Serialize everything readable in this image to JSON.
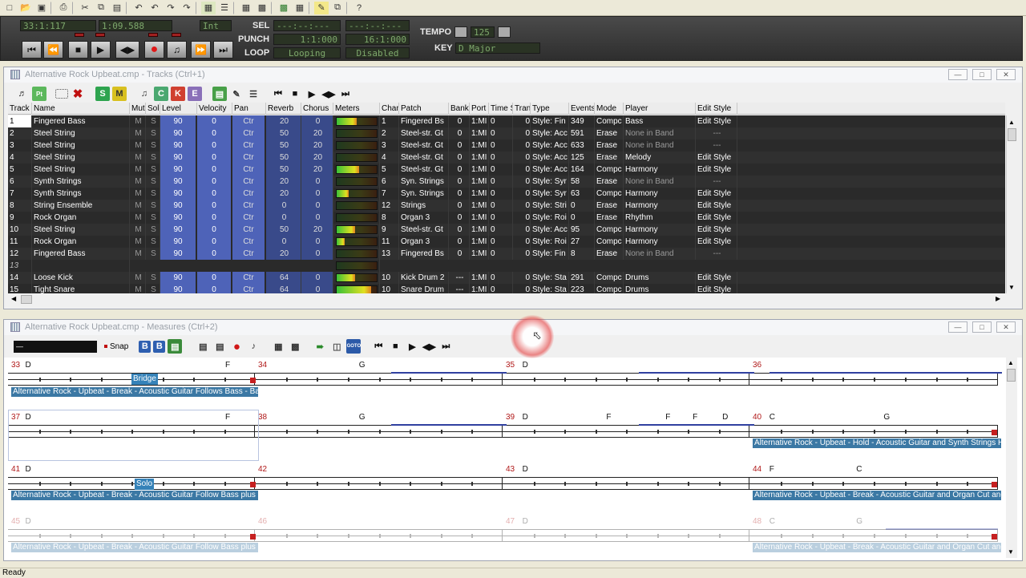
{
  "transport": {
    "now_time": "33:1:117",
    "now_clock": "1:09.588",
    "sync": "Int",
    "sel_label": "SEL",
    "sel_from": "---:--:---",
    "sel_to": "---:--:---",
    "punch_label": "PUNCH",
    "punch_from": "1:1:000",
    "punch_to": "16:1:000",
    "loop_label": "LOOP",
    "loop_from": "Looping",
    "loop_to": "Disabled",
    "tempo_label": "TEMPO",
    "tempo_value": "125",
    "key_label": "KEY",
    "key_value": "D Major"
  },
  "tracks_window": {
    "title": "Alternative Rock Upbeat.cmp - Tracks (Ctrl+1)",
    "columns": [
      "Track",
      "Name",
      "Mut",
      "Solo",
      "Level",
      "Velocity",
      "Pan",
      "Reverb",
      "Chorus",
      "Meters",
      "Chan",
      "Patch",
      "Bank",
      "Port",
      "Time S",
      "Tran",
      "Type",
      "Events",
      "Mode",
      "Player",
      "Edit Style"
    ],
    "rows": [
      {
        "n": "1",
        "name": "Fingered Bass",
        "level": "90",
        "vel": "0",
        "pan": "Ctr",
        "rev": "20",
        "cho": "0",
        "meter": 0.5,
        "chan": "1",
        "patch": "Fingered Bs",
        "bank": "0",
        "port": "1:MI",
        "ts": "0",
        "tran": "0",
        "type": "Style: Fin",
        "events": "349",
        "mode": "Compc",
        "player": "Bass",
        "edit": "Edit Style",
        "playerdim": false
      },
      {
        "n": "2",
        "name": "Steel String",
        "level": "90",
        "vel": "0",
        "pan": "Ctr",
        "rev": "50",
        "cho": "20",
        "meter": 0,
        "chan": "2",
        "patch": "Steel-str. Gt",
        "bank": "0",
        "port": "1:MI",
        "ts": "0",
        "tran": "0",
        "type": "Style: Acc",
        "events": "591",
        "mode": "Erase",
        "player": "None in Band",
        "edit": "---",
        "playerdim": true
      },
      {
        "n": "3",
        "name": "Steel String",
        "level": "90",
        "vel": "0",
        "pan": "Ctr",
        "rev": "50",
        "cho": "20",
        "meter": 0,
        "chan": "3",
        "patch": "Steel-str. Gt",
        "bank": "0",
        "port": "1:MI",
        "ts": "0",
        "tran": "0",
        "type": "Style: Acc",
        "events": "633",
        "mode": "Erase",
        "player": "None in Band",
        "edit": "---",
        "playerdim": true
      },
      {
        "n": "4",
        "name": "Steel String",
        "level": "90",
        "vel": "0",
        "pan": "Ctr",
        "rev": "50",
        "cho": "20",
        "meter": 0,
        "chan": "4",
        "patch": "Steel-str. Gt",
        "bank": "0",
        "port": "1:MI",
        "ts": "0",
        "tran": "0",
        "type": "Style: Acc",
        "events": "125",
        "mode": "Erase",
        "player": "Melody",
        "edit": "Edit Style",
        "playerdim": false
      },
      {
        "n": "5",
        "name": "Steel String",
        "level": "90",
        "vel": "0",
        "pan": "Ctr",
        "rev": "50",
        "cho": "20",
        "meter": 0.55,
        "chan": "5",
        "patch": "Steel-str. Gt",
        "bank": "0",
        "port": "1:MI",
        "ts": "0",
        "tran": "0",
        "type": "Style: Acc",
        "events": "164",
        "mode": "Compc",
        "player": "Harmony",
        "edit": "Edit Style",
        "playerdim": false
      },
      {
        "n": "6",
        "name": "Synth Strings",
        "level": "90",
        "vel": "0",
        "pan": "Ctr",
        "rev": "20",
        "cho": "0",
        "meter": 0,
        "chan": "6",
        "patch": "Syn. Strings",
        "bank": "0",
        "port": "1:MI",
        "ts": "0",
        "tran": "0",
        "type": "Style: Syr",
        "events": "58",
        "mode": "Erase",
        "player": "None in Band",
        "edit": "---",
        "playerdim": true
      },
      {
        "n": "7",
        "name": "Synth Strings",
        "level": "90",
        "vel": "0",
        "pan": "Ctr",
        "rev": "20",
        "cho": "0",
        "meter": 0.3,
        "chan": "7",
        "patch": "Syn. Strings",
        "bank": "0",
        "port": "1:MI",
        "ts": "0",
        "tran": "0",
        "type": "Style: Syr",
        "events": "63",
        "mode": "Compc",
        "player": "Harmony",
        "edit": "Edit Style",
        "playerdim": false
      },
      {
        "n": "8",
        "name": "String Ensemble",
        "level": "90",
        "vel": "0",
        "pan": "Ctr",
        "rev": "0",
        "cho": "0",
        "meter": 0,
        "chan": "12",
        "patch": "Strings",
        "bank": "0",
        "port": "1:MI",
        "ts": "0",
        "tran": "0",
        "type": "Style: Stri",
        "events": "0",
        "mode": "Erase",
        "player": "Harmony",
        "edit": "Edit Style",
        "playerdim": false
      },
      {
        "n": "9",
        "name": "Rock Organ",
        "level": "90",
        "vel": "0",
        "pan": "Ctr",
        "rev": "0",
        "cho": "0",
        "meter": 0,
        "chan": "8",
        "patch": "Organ 3",
        "bank": "0",
        "port": "1:MI",
        "ts": "0",
        "tran": "0",
        "type": "Style: Roi",
        "events": "0",
        "mode": "Erase",
        "player": "Rhythm",
        "edit": "Edit Style",
        "playerdim": false
      },
      {
        "n": "10",
        "name": "Steel String",
        "level": "90",
        "vel": "0",
        "pan": "Ctr",
        "rev": "50",
        "cho": "20",
        "meter": 0.45,
        "chan": "9",
        "patch": "Steel-str. Gt",
        "bank": "0",
        "port": "1:MI",
        "ts": "0",
        "tran": "0",
        "type": "Style: Acc",
        "events": "95",
        "mode": "Compc",
        "player": "Harmony",
        "edit": "Edit Style",
        "playerdim": false
      },
      {
        "n": "11",
        "name": "Rock Organ",
        "level": "90",
        "vel": "0",
        "pan": "Ctr",
        "rev": "0",
        "cho": "0",
        "meter": 0.2,
        "chan": "11",
        "patch": "Organ 3",
        "bank": "0",
        "port": "1:MI",
        "ts": "0",
        "tran": "0",
        "type": "Style: Roi",
        "events": "27",
        "mode": "Compc",
        "player": "Harmony",
        "edit": "Edit Style",
        "playerdim": false
      },
      {
        "n": "12",
        "name": "Fingered Bass",
        "level": "90",
        "vel": "0",
        "pan": "Ctr",
        "rev": "20",
        "cho": "0",
        "meter": 0,
        "chan": "13",
        "patch": "Fingered Bs",
        "bank": "0",
        "port": "1:MI",
        "ts": "0",
        "tran": "0",
        "type": "Style: Fin",
        "events": "8",
        "mode": "Erase",
        "player": "None in Band",
        "edit": "---",
        "playerdim": true
      },
      {
        "n": "13",
        "name": "",
        "level": "",
        "vel": "",
        "pan": "",
        "rev": "",
        "cho": "",
        "meter": 0,
        "chan": "",
        "patch": "",
        "bank": "",
        "port": "",
        "ts": "",
        "tran": "",
        "type": "",
        "events": "",
        "mode": "",
        "player": "",
        "edit": "",
        "playerdim": false,
        "empty": true
      },
      {
        "n": "14",
        "name": "Loose Kick",
        "level": "90",
        "vel": "0",
        "pan": "Ctr",
        "rev": "64",
        "cho": "0",
        "meter": 0.45,
        "chan": "10",
        "patch": "Kick Drum 2",
        "bank": "---",
        "port": "1:MI",
        "ts": "0",
        "tran": "0",
        "type": "Style: Sta",
        "events": "291",
        "mode": "Compc",
        "player": "Drums",
        "edit": "Edit Style",
        "playerdim": false
      },
      {
        "n": "15",
        "name": "Tight Snare",
        "level": "90",
        "vel": "0",
        "pan": "Ctr",
        "rev": "64",
        "cho": "0",
        "meter": 0.85,
        "chan": "10",
        "patch": "Snare Drum",
        "bank": "---",
        "port": "1:MI",
        "ts": "0",
        "tran": "0",
        "type": "Style: Sta",
        "events": "223",
        "mode": "Compc",
        "player": "Drums",
        "edit": "Edit Style",
        "playerdim": false
      }
    ],
    "mute_label": "M",
    "solo_label": "S"
  },
  "measures_window": {
    "title": "Alternative Rock Upbeat.cmp - Measures (Ctrl+2)",
    "snap_label": "Snap",
    "bars": [
      {
        "num": "33",
        "chords": [
          {
            "t": "D",
            "pos": 0.07
          },
          {
            "t": "F",
            "pos": 0.88
          }
        ]
      },
      {
        "num": "34",
        "chords": [
          {
            "t": "G",
            "pos": 0.42
          }
        ]
      },
      {
        "num": "35",
        "chords": [
          {
            "t": "D",
            "pos": 0.08
          }
        ]
      },
      {
        "num": "36",
        "chords": []
      },
      {
        "num": "37",
        "chords": [
          {
            "t": "D",
            "pos": 0.07
          },
          {
            "t": "F",
            "pos": 0.88
          }
        ]
      },
      {
        "num": "38",
        "chords": [
          {
            "t": "G",
            "pos": 0.42
          }
        ]
      },
      {
        "num": "39",
        "chords": [
          {
            "t": "D",
            "pos": 0.08
          },
          {
            "t": "F",
            "pos": 0.42
          },
          {
            "t": "F",
            "pos": 0.66
          },
          {
            "t": "F",
            "pos": 0.77
          },
          {
            "t": "D",
            "pos": 0.89
          }
        ]
      },
      {
        "num": "40",
        "chords": [
          {
            "t": "C",
            "pos": 0.08
          },
          {
            "t": "G",
            "pos": 0.54
          }
        ]
      },
      {
        "num": "41",
        "chords": [
          {
            "t": "D",
            "pos": 0.07
          }
        ]
      },
      {
        "num": "42",
        "chords": []
      },
      {
        "num": "43",
        "chords": [
          {
            "t": "D",
            "pos": 0.08
          }
        ]
      },
      {
        "num": "44",
        "chords": [
          {
            "t": "F",
            "pos": 0.08
          },
          {
            "t": "C",
            "pos": 0.43
          }
        ]
      },
      {
        "num": "45",
        "chords": [
          {
            "t": "D",
            "pos": 0.07
          }
        ]
      },
      {
        "num": "46",
        "chords": []
      },
      {
        "num": "47",
        "chords": [
          {
            "t": "D",
            "pos": 0.08
          }
        ]
      },
      {
        "num": "48",
        "chords": [
          {
            "t": "C",
            "pos": 0.08
          },
          {
            "t": "G",
            "pos": 0.43
          }
        ]
      }
    ],
    "tags": {
      "bridge": "Bridge",
      "solo": "Solo"
    },
    "lyrics": {
      "r1": "Alternative Rock - Upbeat - Break - Acoustic Guitar Follows Bass - Bass J",
      "r2": "Alternative Rock - Upbeat - Hold - Acoustic Guitar and Synth Strings Hold",
      "r3a": "Alternative Rock - Upbeat - Break - Acoustic Guitar Follow Bass plus Harr",
      "r3b": "Alternative Rock - Upbeat - Break - Acoustic Guitar and Organ Cut and H",
      "r4a": "Alternative Rock - Upbeat - Break - Acoustic Guitar Follow Bass plus Harr",
      "r4b": "Alternative Rock - Upbeat - Break - Acoustic Guitar and Organ Cut and H"
    }
  },
  "status": {
    "text": "Ready"
  }
}
